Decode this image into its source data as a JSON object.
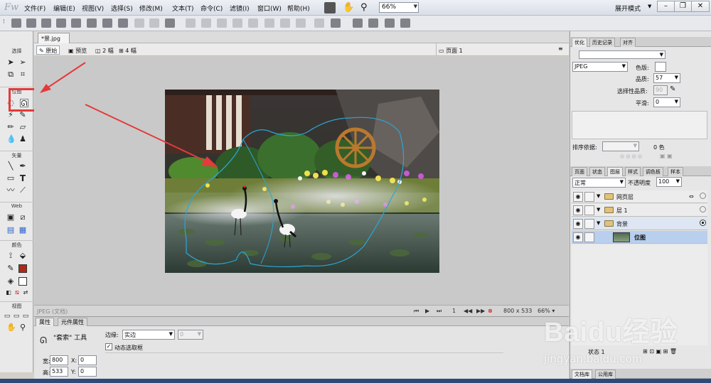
{
  "app": {
    "logo": "Fw"
  },
  "menu": [
    "文件(F)",
    "编辑(E)",
    "视图(V)",
    "选择(S)",
    "修改(M)",
    "文本(T)",
    "命令(C)",
    "滤镜(I)",
    "窗口(W)",
    "帮助(H)"
  ],
  "toolbar": {
    "zoom": "66%",
    "workspace": "展开模式"
  },
  "tools": {
    "sections": [
      "选择",
      "位图",
      "矢量",
      "Web",
      "颜色",
      "视图"
    ]
  },
  "document": {
    "tab": "*景.jpg",
    "views": [
      "原始",
      "预览",
      "2 幅",
      "4 幅"
    ],
    "page": "页面 1",
    "format_label": "JPEG (文档)",
    "frame": "1",
    "size": "800 x 533",
    "zoom": "66%"
  },
  "properties": {
    "tabs": [
      "属性",
      "元件属性"
    ],
    "tool_name": "\"套索\" 工具",
    "edge_label": "边缘:",
    "edge_value": "实边",
    "edge_amount": "0",
    "dynamic_label": "动态选取框",
    "w_label": "宽:",
    "w": "800",
    "h_label": "高:",
    "h": "533",
    "x_label": "X:",
    "x": "0",
    "y_label": "Y:",
    "y": "0"
  },
  "optimize": {
    "tabs": [
      "优化",
      "历史记录",
      "对齐"
    ],
    "format": "JPEG",
    "matte_label": "色版:",
    "quality_label": "品质:",
    "quality": "57",
    "sel_quality_label": "选择性品质:",
    "sel_quality": "90",
    "smooth_label": "平滑:",
    "smooth": "0",
    "sort_label": "排序依据:",
    "colors": "0 色"
  },
  "layers": {
    "tabs": [
      "页面",
      "状态",
      "图层",
      "样式",
      "调色板",
      "样本"
    ],
    "blend": "正常",
    "opacity_label": "不透明度",
    "opacity": "100",
    "rows": [
      {
        "name": "网页层",
        "indent": 0
      },
      {
        "name": "层 1",
        "indent": 0
      },
      {
        "name": "背景",
        "indent": 0
      },
      {
        "name": "位图",
        "indent": 1
      }
    ],
    "state": "状态 1"
  },
  "bottom_tabs": [
    "文档库",
    "公用库"
  ],
  "watermark": {
    "brand": "Baidu经验",
    "url": "jingyan.baidu.com"
  },
  "colors": {
    "accent_red": "#e43a3a",
    "selection_blue": "#b8cfee",
    "marquee": "#2aa7d6"
  }
}
